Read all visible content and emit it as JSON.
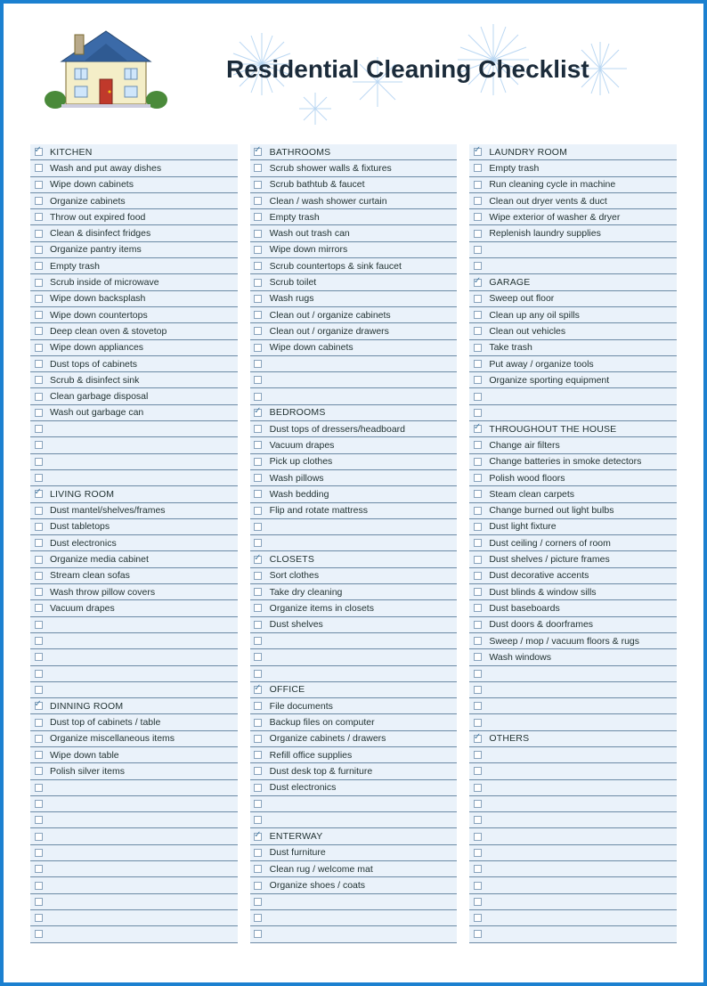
{
  "title": "Residential Cleaning Checklist",
  "columns": [
    [
      {
        "type": "header",
        "label": "KITCHEN"
      },
      {
        "type": "item",
        "label": "Wash and put away dishes"
      },
      {
        "type": "item",
        "label": "Wipe down cabinets"
      },
      {
        "type": "item",
        "label": "Organize cabinets"
      },
      {
        "type": "item",
        "label": "Throw out expired food"
      },
      {
        "type": "item",
        "label": "Clean & disinfect fridges"
      },
      {
        "type": "item",
        "label": "Organize pantry items"
      },
      {
        "type": "item",
        "label": "Empty trash"
      },
      {
        "type": "item",
        "label": "Scrub inside of microwave"
      },
      {
        "type": "item",
        "label": "Wipe down backsplash"
      },
      {
        "type": "item",
        "label": "Wipe down countertops"
      },
      {
        "type": "item",
        "label": "Deep clean oven & stovetop"
      },
      {
        "type": "item",
        "label": "Wipe down appliances"
      },
      {
        "type": "item",
        "label": "Dust tops of cabinets"
      },
      {
        "type": "item",
        "label": "Scrub & disinfect sink"
      },
      {
        "type": "item",
        "label": "Clean garbage disposal"
      },
      {
        "type": "item",
        "label": "Wash out garbage can"
      },
      {
        "type": "empty"
      },
      {
        "type": "empty"
      },
      {
        "type": "empty"
      },
      {
        "type": "empty"
      },
      {
        "type": "header",
        "label": "LIVING ROOM"
      },
      {
        "type": "item",
        "label": "Dust mantel/shelves/frames"
      },
      {
        "type": "item",
        "label": "Dust tabletops"
      },
      {
        "type": "item",
        "label": "Dust electronics"
      },
      {
        "type": "item",
        "label": "Organize media cabinet"
      },
      {
        "type": "item",
        "label": "Stream clean sofas"
      },
      {
        "type": "item",
        "label": "Wash throw pillow covers"
      },
      {
        "type": "item",
        "label": "Vacuum drapes"
      },
      {
        "type": "empty"
      },
      {
        "type": "empty"
      },
      {
        "type": "empty"
      },
      {
        "type": "empty"
      },
      {
        "type": "empty"
      },
      {
        "type": "header",
        "label": "DINNING ROOM"
      },
      {
        "type": "item",
        "label": "Dust top of cabinets / table"
      },
      {
        "type": "item",
        "label": "Organize miscellaneous items"
      },
      {
        "type": "item",
        "label": "Wipe down table"
      },
      {
        "type": "item",
        "label": "Polish silver items"
      },
      {
        "type": "empty"
      },
      {
        "type": "empty"
      },
      {
        "type": "empty"
      },
      {
        "type": "empty"
      },
      {
        "type": "empty"
      },
      {
        "type": "empty"
      },
      {
        "type": "empty"
      },
      {
        "type": "empty"
      },
      {
        "type": "empty"
      },
      {
        "type": "empty"
      }
    ],
    [
      {
        "type": "header",
        "label": "BATHROOMS"
      },
      {
        "type": "item",
        "label": "Scrub shower walls & fixtures"
      },
      {
        "type": "item",
        "label": "Scrub bathtub & faucet"
      },
      {
        "type": "item",
        "label": "Clean / wash shower curtain"
      },
      {
        "type": "item",
        "label": "Empty trash"
      },
      {
        "type": "item",
        "label": "Wash out trash can"
      },
      {
        "type": "item",
        "label": "Wipe down mirrors"
      },
      {
        "type": "item",
        "label": "Scrub countertops & sink faucet"
      },
      {
        "type": "item",
        "label": "Scrub toilet"
      },
      {
        "type": "item",
        "label": "Wash rugs"
      },
      {
        "type": "item",
        "label": "Clean out / organize cabinets"
      },
      {
        "type": "item",
        "label": "Clean out / organize drawers"
      },
      {
        "type": "item",
        "label": "Wipe down cabinets"
      },
      {
        "type": "empty"
      },
      {
        "type": "empty"
      },
      {
        "type": "empty"
      },
      {
        "type": "header",
        "label": "BEDROOMS"
      },
      {
        "type": "item",
        "label": "Dust tops of dressers/headboard"
      },
      {
        "type": "item",
        "label": "Vacuum drapes"
      },
      {
        "type": "item",
        "label": "Pick up clothes"
      },
      {
        "type": "item",
        "label": "Wash pillows"
      },
      {
        "type": "item",
        "label": "Wash bedding"
      },
      {
        "type": "item",
        "label": "Flip and rotate mattress"
      },
      {
        "type": "empty"
      },
      {
        "type": "empty"
      },
      {
        "type": "header",
        "label": "CLOSETS"
      },
      {
        "type": "item",
        "label": "Sort clothes"
      },
      {
        "type": "item",
        "label": "Take dry cleaning"
      },
      {
        "type": "item",
        "label": "Organize items in closets"
      },
      {
        "type": "item",
        "label": "Dust shelves"
      },
      {
        "type": "empty"
      },
      {
        "type": "empty"
      },
      {
        "type": "empty"
      },
      {
        "type": "header",
        "label": "OFFICE"
      },
      {
        "type": "item",
        "label": "File documents"
      },
      {
        "type": "item",
        "label": "Backup files on computer"
      },
      {
        "type": "item",
        "label": "Organize cabinets / drawers"
      },
      {
        "type": "item",
        "label": "Refill office supplies"
      },
      {
        "type": "item",
        "label": "Dust desk top & furniture"
      },
      {
        "type": "item",
        "label": "Dust electronics"
      },
      {
        "type": "empty"
      },
      {
        "type": "empty"
      },
      {
        "type": "header",
        "label": "ENTERWAY"
      },
      {
        "type": "item",
        "label": "Dust furniture"
      },
      {
        "type": "item",
        "label": "Clean rug / welcome mat"
      },
      {
        "type": "item",
        "label": "Organize shoes / coats"
      },
      {
        "type": "empty"
      },
      {
        "type": "empty"
      },
      {
        "type": "empty"
      }
    ],
    [
      {
        "type": "header",
        "label": "LAUNDRY ROOM"
      },
      {
        "type": "item",
        "label": "Empty trash"
      },
      {
        "type": "item",
        "label": "Run cleaning cycle in machine"
      },
      {
        "type": "item",
        "label": "Clean out dryer vents & duct"
      },
      {
        "type": "item",
        "label": "Wipe exterior of washer & dryer"
      },
      {
        "type": "item",
        "label": "Replenish laundry supplies"
      },
      {
        "type": "empty"
      },
      {
        "type": "empty"
      },
      {
        "type": "header",
        "label": "GARAGE"
      },
      {
        "type": "item",
        "label": "Sweep out floor"
      },
      {
        "type": "item",
        "label": "Clean up any oil spills"
      },
      {
        "type": "item",
        "label": "Clean out vehicles"
      },
      {
        "type": "item",
        "label": "Take trash"
      },
      {
        "type": "item",
        "label": "Put away / organize tools"
      },
      {
        "type": "item",
        "label": "Organize sporting equipment"
      },
      {
        "type": "empty"
      },
      {
        "type": "empty"
      },
      {
        "type": "header",
        "label": "THROUGHOUT THE HOUSE"
      },
      {
        "type": "item",
        "label": "Change air filters"
      },
      {
        "type": "item",
        "label": "Change batteries in smoke detectors"
      },
      {
        "type": "item",
        "label": "Polish wood floors"
      },
      {
        "type": "item",
        "label": "Steam clean carpets"
      },
      {
        "type": "item",
        "label": "Change burned out light bulbs"
      },
      {
        "type": "item",
        "label": "Dust light fixture"
      },
      {
        "type": "item",
        "label": "Dust ceiling / corners of room"
      },
      {
        "type": "item",
        "label": "Dust shelves / picture frames"
      },
      {
        "type": "item",
        "label": "Dust decorative accents"
      },
      {
        "type": "item",
        "label": "Dust blinds & window sills"
      },
      {
        "type": "item",
        "label": "Dust baseboards"
      },
      {
        "type": "item",
        "label": "Dust doors & doorframes"
      },
      {
        "type": "item",
        "label": "Sweep / mop / vacuum floors & rugs"
      },
      {
        "type": "item",
        "label": "Wash windows"
      },
      {
        "type": "empty"
      },
      {
        "type": "empty"
      },
      {
        "type": "empty"
      },
      {
        "type": "empty"
      },
      {
        "type": "header",
        "label": "OTHERS"
      },
      {
        "type": "empty"
      },
      {
        "type": "empty"
      },
      {
        "type": "empty"
      },
      {
        "type": "empty"
      },
      {
        "type": "empty"
      },
      {
        "type": "empty"
      },
      {
        "type": "empty"
      },
      {
        "type": "empty"
      },
      {
        "type": "empty"
      },
      {
        "type": "empty"
      },
      {
        "type": "empty"
      },
      {
        "type": "empty"
      }
    ]
  ]
}
